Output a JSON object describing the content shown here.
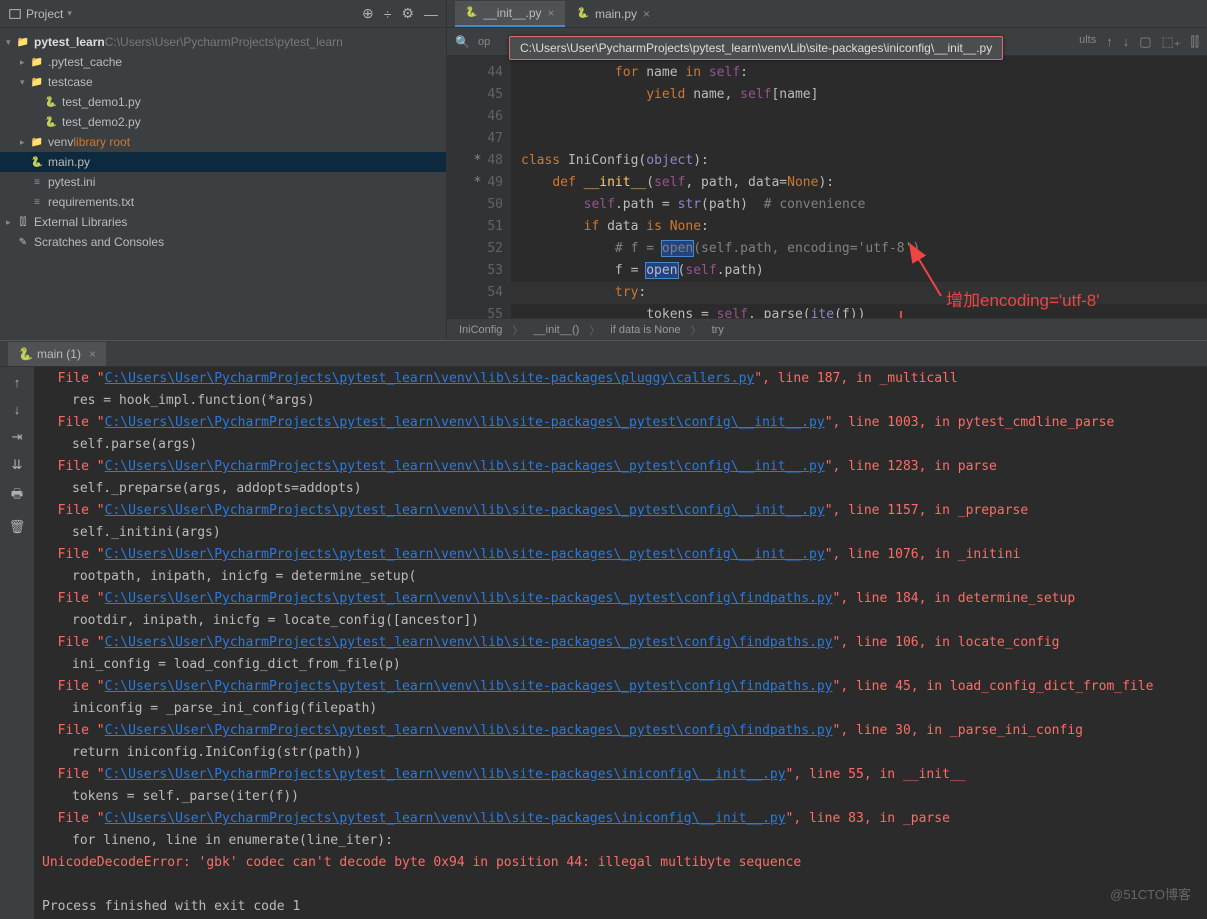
{
  "sidebar": {
    "title": "Project",
    "tree": [
      {
        "indent": 0,
        "arrow": "▾",
        "icon": "folder",
        "label": "pytest_learn",
        "suffix": "C:\\Users\\User\\PycharmProjects\\pytest_learn",
        "bold": true
      },
      {
        "indent": 1,
        "arrow": "▸",
        "icon": "folder",
        "label": ".pytest_cache",
        "suffix": ""
      },
      {
        "indent": 1,
        "arrow": "▾",
        "icon": "folder",
        "label": "testcase",
        "suffix": ""
      },
      {
        "indent": 2,
        "arrow": "",
        "icon": "py",
        "label": "test_demo1.py",
        "suffix": ""
      },
      {
        "indent": 2,
        "arrow": "",
        "icon": "py",
        "label": "test_demo2.py",
        "suffix": ""
      },
      {
        "indent": 1,
        "arrow": "▸",
        "icon": "folder",
        "label": "venv",
        "suffix": "library root",
        "orange": true
      },
      {
        "indent": 1,
        "arrow": "",
        "icon": "py",
        "label": "main.py",
        "suffix": "",
        "selected": true
      },
      {
        "indent": 1,
        "arrow": "",
        "icon": "txt",
        "label": "pytest.ini",
        "suffix": ""
      },
      {
        "indent": 1,
        "arrow": "",
        "icon": "txt",
        "label": "requirements.txt",
        "suffix": ""
      },
      {
        "indent": 0,
        "arrow": "▸",
        "icon": "lib",
        "label": "External Libraries",
        "suffix": ""
      },
      {
        "indent": 0,
        "arrow": "",
        "icon": "scratch",
        "label": "Scratches and Consoles",
        "suffix": ""
      }
    ]
  },
  "editor": {
    "tabs": [
      {
        "label": "__init__.py",
        "active": true
      },
      {
        "label": "main.py",
        "active": false
      }
    ],
    "search_label": "op",
    "search_right": "ults",
    "tooltip": "C:\\Users\\User\\PycharmProjects\\pytest_learn\\venv\\Lib\\site-packages\\iniconfig\\__init__.py",
    "lines": [
      {
        "n": 44,
        "html": "            <span class='kw'>for</span> name <span class='kw'>in</span> <span class='self'>self</span>:"
      },
      {
        "n": 45,
        "html": "                <span class='kw'>yield</span> name, <span class='self'>self</span>[name]"
      },
      {
        "n": 46,
        "html": ""
      },
      {
        "n": 47,
        "html": ""
      },
      {
        "n": 48,
        "star": true,
        "html": "<span class='kw'>class</span> <span>IniConfig</span>(<span class='bi'>object</span>):"
      },
      {
        "n": 49,
        "star": true,
        "html": "    <span class='kw'>def</span> <span class='fn'>__init__</span>(<span class='self'>self</span>, path, data=<span class='kw'>None</span>):"
      },
      {
        "n": 50,
        "html": "        <span class='self'>self</span>.path = <span class='bi'>str</span>(path)  <span class='cmt'># convenience</span>"
      },
      {
        "n": 51,
        "html": "        <span class='kw'>if</span> data <span class='kw'>is</span> <span class='kw'>None</span>:"
      },
      {
        "n": 52,
        "html": "            <span class='cmt'># f = <span class='hl-box'>open</span>(self.path, encoding='utf-8')</span>"
      },
      {
        "n": 53,
        "html": "            f = <span class='hl-box'>open</span>(<span class='self'>self</span>.path)"
      },
      {
        "n": 54,
        "hl": true,
        "html": "            <span class='kw'>try</span>:"
      },
      {
        "n": 55,
        "html": "                tokens = <span class='self'>self</span>._parse(<span class='bi'>ite</span>(f))"
      }
    ],
    "breadcrumb": [
      "IniConfig",
      "__init__()",
      "if data is None",
      "try"
    ]
  },
  "annotation": "增加encoding='utf-8'",
  "run": {
    "tab": "main (1)"
  },
  "traceback": [
    {
      "t": "file",
      "pre": "  File \"",
      "path": "C:\\Users\\User\\PycharmProjects\\pytest_learn\\venv\\lib\\site-packages\\pluggy\\callers.py",
      "post": "\", line 187, in _multicall"
    },
    {
      "t": "sub",
      "text": "res = hook_impl.function(*args)"
    },
    {
      "t": "file",
      "pre": "  File \"",
      "path": "C:\\Users\\User\\PycharmProjects\\pytest_learn\\venv\\lib\\site-packages\\_pytest\\config\\__init__.py",
      "post": "\", line 1003, in pytest_cmdline_parse"
    },
    {
      "t": "sub",
      "text": "self.parse(args)"
    },
    {
      "t": "file",
      "pre": "  File \"",
      "path": "C:\\Users\\User\\PycharmProjects\\pytest_learn\\venv\\lib\\site-packages\\_pytest\\config\\__init__.py",
      "post": "\", line 1283, in parse"
    },
    {
      "t": "sub",
      "text": "self._preparse(args, addopts=addopts)"
    },
    {
      "t": "file",
      "pre": "  File \"",
      "path": "C:\\Users\\User\\PycharmProjects\\pytest_learn\\venv\\lib\\site-packages\\_pytest\\config\\__init__.py",
      "post": "\", line 1157, in _preparse"
    },
    {
      "t": "sub",
      "text": "self._initini(args)"
    },
    {
      "t": "file",
      "pre": "  File \"",
      "path": "C:\\Users\\User\\PycharmProjects\\pytest_learn\\venv\\lib\\site-packages\\_pytest\\config\\__init__.py",
      "post": "\", line 1076, in _initini"
    },
    {
      "t": "sub",
      "text": "rootpath, inipath, inicfg = determine_setup("
    },
    {
      "t": "file",
      "pre": "  File \"",
      "path": "C:\\Users\\User\\PycharmProjects\\pytest_learn\\venv\\lib\\site-packages\\_pytest\\config\\findpaths.py",
      "post": "\", line 184, in determine_setup"
    },
    {
      "t": "sub",
      "text": "rootdir, inipath, inicfg = locate_config([ancestor])"
    },
    {
      "t": "file",
      "pre": "  File \"",
      "path": "C:\\Users\\User\\PycharmProjects\\pytest_learn\\venv\\lib\\site-packages\\_pytest\\config\\findpaths.py",
      "post": "\", line 106, in locate_config"
    },
    {
      "t": "sub",
      "text": "ini_config = load_config_dict_from_file(p)"
    },
    {
      "t": "file",
      "pre": "  File \"",
      "path": "C:\\Users\\User\\PycharmProjects\\pytest_learn\\venv\\lib\\site-packages\\_pytest\\config\\findpaths.py",
      "post": "\", line 45, in load_config_dict_from_file"
    },
    {
      "t": "sub",
      "text": "iniconfig = _parse_ini_config(filepath)"
    },
    {
      "t": "file",
      "pre": "  File \"",
      "path": "C:\\Users\\User\\PycharmProjects\\pytest_learn\\venv\\lib\\site-packages\\_pytest\\config\\findpaths.py",
      "post": "\", line 30, in _parse_ini_config"
    },
    {
      "t": "sub",
      "text": "return iniconfig.IniConfig(str(path))"
    },
    {
      "t": "file",
      "pre": "  File \"",
      "path": "C:\\Users\\User\\PycharmProjects\\pytest_learn\\venv\\lib\\site-packages\\iniconfig\\__init__.py",
      "post": "\", line 55, in __init__"
    },
    {
      "t": "sub",
      "text": "tokens = self._parse(iter(f))"
    },
    {
      "t": "file",
      "pre": "  File \"",
      "path": "C:\\Users\\User\\PycharmProjects\\pytest_learn\\venv\\lib\\site-packages\\iniconfig\\__init__.py",
      "post": "\", line 83, in _parse"
    },
    {
      "t": "sub",
      "text": "for lineno, line in enumerate(line_iter):"
    },
    {
      "t": "err",
      "text": "UnicodeDecodeError: 'gbk' codec can't decode byte 0x94 in position 44: illegal multibyte sequence"
    },
    {
      "t": "blank"
    },
    {
      "t": "exit",
      "text": "Process finished with exit code 1"
    }
  ],
  "watermark": "@51CTO博客"
}
